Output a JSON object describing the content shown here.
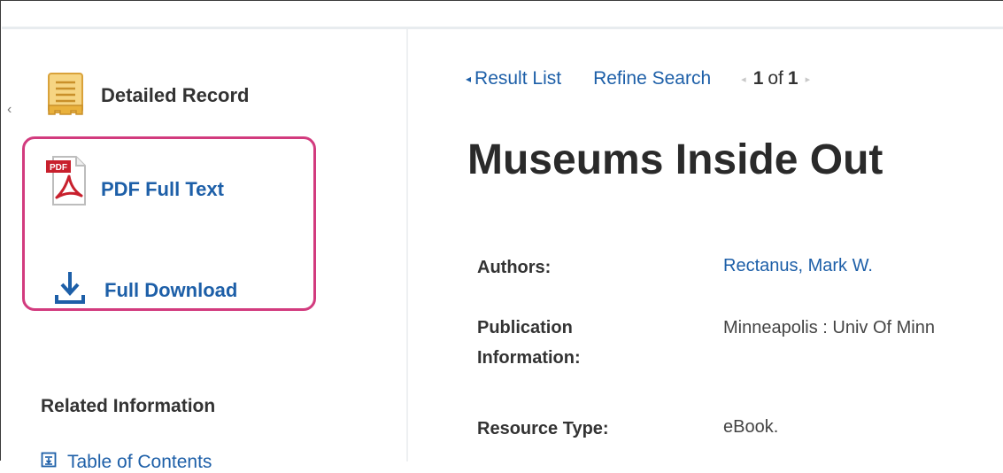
{
  "sidebar": {
    "detailed_record_label": "Detailed Record",
    "pdf_full_text_label": "PDF Full Text",
    "pdf_badge": "PDF",
    "full_download_label": "Full Download",
    "related_information_heading": "Related Information",
    "table_of_contents_label": "Table of Contents",
    "highlight_color": "#d23b7e"
  },
  "nav": {
    "result_list_label": "Result List",
    "refine_search_label": "Refine Search",
    "current_page": "1",
    "of_label": "of",
    "total_pages": "1"
  },
  "record": {
    "title": "Museums Inside Out",
    "fields": {
      "authors_label": "Authors:",
      "authors_value": "Rectanus, Mark W.",
      "publication_label": "Publication Information:",
      "publication_value": "Minneapolis : Univ Of Minn",
      "resource_type_label": "Resource Type:",
      "resource_type_value": "eBook."
    }
  },
  "colors": {
    "link": "#1d5fa8",
    "text": "#333333",
    "pdf_red": "#c8202d",
    "record_icon_gold": "#e9b13c"
  }
}
